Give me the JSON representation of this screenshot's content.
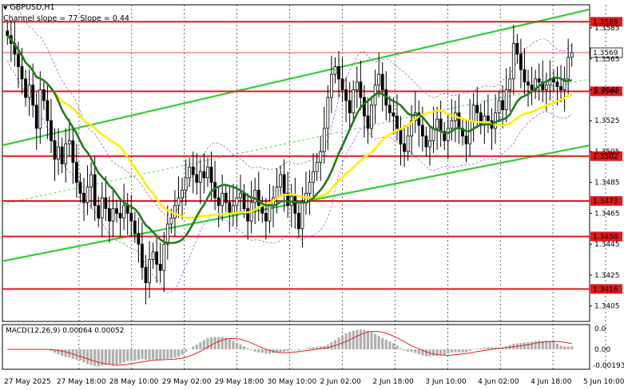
{
  "window": {
    "symbol_title": "GBPUSD,H1",
    "indicator_label": "Channel slope = 77 Slope = 0.44"
  },
  "colors": {
    "background": "#ffffff",
    "candle": "#000000",
    "support_line": "#e0191c",
    "channel": "#33cc33",
    "ma_fast": "#1f7a1f",
    "ma_slow": "#ffee00",
    "envelope": "#a050d0",
    "macd_hist": "#b0b0b0",
    "macd_signal": "#e02020",
    "grid": "#000000"
  },
  "chart_data": {
    "type": "candlestick",
    "symbol": "GBPUSD",
    "timeframe": "H1",
    "y_range": [
      1.3395,
      1.36
    ],
    "price_axis_ticks": [
      "1.3585",
      "1.3565",
      "1.3545",
      "1.3525",
      "1.3505",
      "1.3485",
      "1.3465",
      "1.3445",
      "1.3425",
      "1.3405"
    ],
    "horizontal_levels": [
      "1.3589",
      "1.3544",
      "1.3502",
      "1.3473",
      "1.3450",
      "1.3416"
    ],
    "current_price": "1.3569",
    "time_axis_labels": [
      "27 May 2025",
      "27 May 18:00",
      "28 May 10:00",
      "29 May 02:00",
      "29 May 18:00",
      "30 May 10:00",
      "2 Jun 02:00",
      "2 Jun 18:00",
      "3 Jun 10:00",
      "4 Jun 02:00",
      "4 Jun 18:00",
      "5 Jun 10:00"
    ],
    "macd": {
      "label": "MACD(12,26,9) 0.00064 0.00052",
      "axis_ticks": [
        "0.00",
        "-0.00193"
      ],
      "top_value": "0.0"
    },
    "closes": [
      1.358,
      1.3575,
      1.3568,
      1.356,
      1.3552,
      1.354,
      1.3548,
      1.3535,
      1.352,
      1.3545,
      1.3538,
      1.3525,
      1.3512,
      1.35,
      1.3508,
      1.3497,
      1.351,
      1.3512,
      1.3498,
      1.3485,
      1.3478,
      1.3472,
      1.3482,
      1.349,
      1.347,
      1.3462,
      1.3475,
      1.3468,
      1.346,
      1.3468,
      1.3465,
      1.3462,
      1.347,
      1.3465,
      1.346,
      1.3452,
      1.3445,
      1.343,
      1.342,
      1.3435,
      1.344,
      1.3432,
      1.3428,
      1.3445,
      1.3458,
      1.3462,
      1.347,
      1.3475,
      1.348,
      1.3488,
      1.3495,
      1.349,
      1.3485,
      1.3492,
      1.3488,
      1.3495,
      1.3485,
      1.3475,
      1.347,
      1.3478,
      1.3472,
      1.3465,
      1.347,
      1.3475,
      1.3478,
      1.3468,
      1.346,
      1.3472,
      1.348,
      1.347,
      1.3465,
      1.346,
      1.347,
      1.3475,
      1.3482,
      1.349,
      1.3478,
      1.347,
      1.3476,
      1.3465,
      1.3455,
      1.3472,
      1.3478,
      1.3485,
      1.3492,
      1.3498,
      1.3505,
      1.352,
      1.354,
      1.3555,
      1.356,
      1.3552,
      1.3545,
      1.3538,
      1.353,
      1.3545,
      1.355,
      1.354,
      1.3528,
      1.352,
      1.3535,
      1.3548,
      1.3555,
      1.3545,
      1.3535,
      1.353,
      1.3528,
      1.352,
      1.351,
      1.3505,
      1.3515,
      1.3525,
      1.353,
      1.3522,
      1.3515,
      1.3508,
      1.3512,
      1.352,
      1.3526,
      1.3518,
      1.3512,
      1.352,
      1.3525,
      1.353,
      1.352,
      1.3515,
      1.351,
      1.3525,
      1.3535,
      1.353,
      1.3522,
      1.3528,
      1.3525,
      1.352,
      1.353,
      1.3538,
      1.3532,
      1.3545,
      1.3552,
      1.3575,
      1.3568,
      1.3558,
      1.355,
      1.3548,
      1.3545,
      1.3552,
      1.355,
      1.3545,
      1.3548,
      1.3552,
      1.355,
      1.3547,
      1.3545,
      1.3552,
      1.3566,
      1.3569
    ]
  }
}
